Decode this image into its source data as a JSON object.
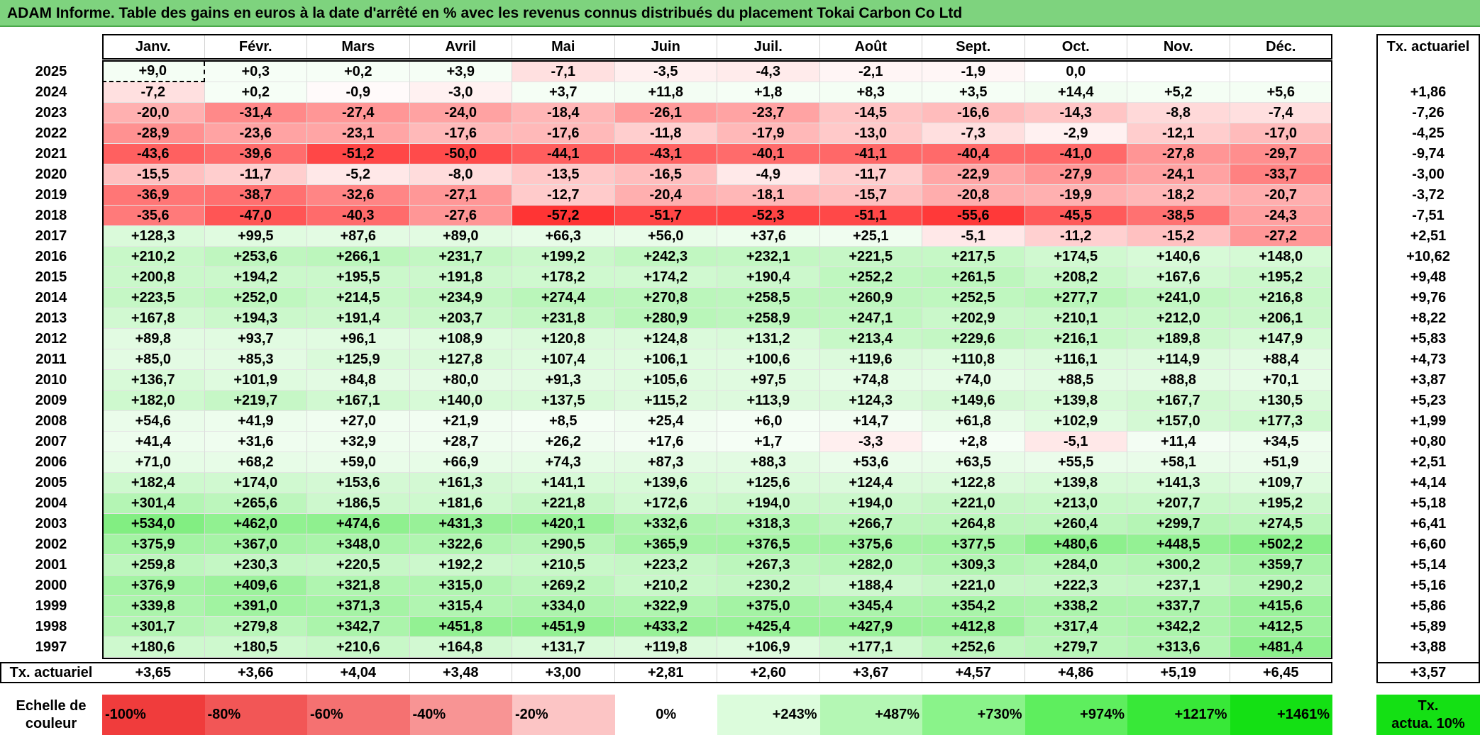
{
  "title": "ADAM Informe. Table des gains en euros à la date d'arrêté en % avec les revenus connus distribués du placement Tokai Carbon Co Ltd",
  "chart_data": {
    "type": "heatmap",
    "title": "ADAM Informe. Table des gains en euros à la date d'arrêté en % avec les revenus connus distribués du placement Tokai Carbon Co Ltd",
    "columns": [
      "Janv.",
      "Févr.",
      "Mars",
      "Avril",
      "Mai",
      "Juin",
      "Juil.",
      "Août",
      "Sept.",
      "Oct.",
      "Nov.",
      "Déc."
    ],
    "right_header": "Tx. actuariel",
    "rows": [
      {
        "year": "2025",
        "values": [
          "+9,0",
          "+0,3",
          "+0,2",
          "+3,9",
          "-7,1",
          "-3,5",
          "-4,3",
          "-2,1",
          "-1,9",
          "0,0",
          "",
          ""
        ],
        "rate": ""
      },
      {
        "year": "2024",
        "values": [
          "-7,2",
          "+0,2",
          "-0,9",
          "-3,0",
          "+3,7",
          "+11,8",
          "+1,8",
          "+8,3",
          "+3,5",
          "+14,4",
          "+5,2",
          "+5,6"
        ],
        "rate": "+1,86"
      },
      {
        "year": "2023",
        "values": [
          "-20,0",
          "-31,4",
          "-27,4",
          "-24,0",
          "-18,4",
          "-26,1",
          "-23,7",
          "-14,5",
          "-16,6",
          "-14,3",
          "-8,8",
          "-7,4"
        ],
        "rate": "-7,26"
      },
      {
        "year": "2022",
        "values": [
          "-28,9",
          "-23,6",
          "-23,1",
          "-17,6",
          "-17,6",
          "-11,8",
          "-17,9",
          "-13,0",
          "-7,3",
          "-2,9",
          "-12,1",
          "-17,0"
        ],
        "rate": "-4,25"
      },
      {
        "year": "2021",
        "values": [
          "-43,6",
          "-39,6",
          "-51,2",
          "-50,0",
          "-44,1",
          "-43,1",
          "-40,1",
          "-41,1",
          "-40,4",
          "-41,0",
          "-27,8",
          "-29,7"
        ],
        "rate": "-9,74"
      },
      {
        "year": "2020",
        "values": [
          "-15,5",
          "-11,7",
          "-5,2",
          "-8,0",
          "-13,5",
          "-16,5",
          "-4,9",
          "-11,7",
          "-22,9",
          "-27,9",
          "-24,1",
          "-33,7"
        ],
        "rate": "-3,00"
      },
      {
        "year": "2019",
        "values": [
          "-36,9",
          "-38,7",
          "-32,6",
          "-27,1",
          "-12,7",
          "-20,4",
          "-18,1",
          "-15,7",
          "-20,8",
          "-19,9",
          "-18,2",
          "-20,7"
        ],
        "rate": "-3,72"
      },
      {
        "year": "2018",
        "values": [
          "-35,6",
          "-47,0",
          "-40,3",
          "-27,6",
          "-57,2",
          "-51,7",
          "-52,3",
          "-51,1",
          "-55,6",
          "-45,5",
          "-38,5",
          "-24,3"
        ],
        "rate": "-7,51"
      },
      {
        "year": "2017",
        "values": [
          "+128,3",
          "+99,5",
          "+87,6",
          "+89,0",
          "+66,3",
          "+56,0",
          "+37,6",
          "+25,1",
          "-5,1",
          "-11,2",
          "-15,2",
          "-27,2"
        ],
        "rate": "+2,51"
      },
      {
        "year": "2016",
        "values": [
          "+210,2",
          "+253,6",
          "+266,1",
          "+231,7",
          "+199,2",
          "+242,3",
          "+232,1",
          "+221,5",
          "+217,5",
          "+174,5",
          "+140,6",
          "+148,0"
        ],
        "rate": "+10,62"
      },
      {
        "year": "2015",
        "values": [
          "+200,8",
          "+194,2",
          "+195,5",
          "+191,8",
          "+178,2",
          "+174,2",
          "+190,4",
          "+252,2",
          "+261,5",
          "+208,2",
          "+167,6",
          "+195,2"
        ],
        "rate": "+9,48"
      },
      {
        "year": "2014",
        "values": [
          "+223,5",
          "+252,0",
          "+214,5",
          "+234,9",
          "+274,4",
          "+270,8",
          "+258,5",
          "+260,9",
          "+252,5",
          "+277,7",
          "+241,0",
          "+216,8"
        ],
        "rate": "+9,76"
      },
      {
        "year": "2013",
        "values": [
          "+167,8",
          "+194,3",
          "+191,4",
          "+203,7",
          "+231,8",
          "+280,9",
          "+258,9",
          "+247,1",
          "+202,9",
          "+210,1",
          "+212,0",
          "+206,1"
        ],
        "rate": "+8,22"
      },
      {
        "year": "2012",
        "values": [
          "+89,8",
          "+93,7",
          "+96,1",
          "+108,9",
          "+120,8",
          "+124,8",
          "+131,2",
          "+213,4",
          "+229,6",
          "+216,1",
          "+189,8",
          "+147,9"
        ],
        "rate": "+5,83"
      },
      {
        "year": "2011",
        "values": [
          "+85,0",
          "+85,3",
          "+125,9",
          "+127,8",
          "+107,4",
          "+106,1",
          "+100,6",
          "+119,6",
          "+110,8",
          "+116,1",
          "+114,9",
          "+88,4"
        ],
        "rate": "+4,73"
      },
      {
        "year": "2010",
        "values": [
          "+136,7",
          "+101,9",
          "+84,8",
          "+80,0",
          "+91,3",
          "+105,6",
          "+97,5",
          "+74,8",
          "+74,0",
          "+88,5",
          "+88,8",
          "+70,1"
        ],
        "rate": "+3,87"
      },
      {
        "year": "2009",
        "values": [
          "+182,0",
          "+219,7",
          "+167,1",
          "+140,0",
          "+137,5",
          "+115,2",
          "+113,9",
          "+124,3",
          "+149,6",
          "+139,8",
          "+167,7",
          "+130,5"
        ],
        "rate": "+5,23"
      },
      {
        "year": "2008",
        "values": [
          "+54,6",
          "+41,9",
          "+27,0",
          "+21,9",
          "+8,5",
          "+25,4",
          "+6,0",
          "+14,7",
          "+61,8",
          "+102,9",
          "+157,0",
          "+177,3"
        ],
        "rate": "+1,99"
      },
      {
        "year": "2007",
        "values": [
          "+41,4",
          "+31,6",
          "+32,9",
          "+28,7",
          "+26,2",
          "+17,6",
          "+1,7",
          "-3,3",
          "+2,8",
          "-5,1",
          "+11,4",
          "+34,5"
        ],
        "rate": "+0,80"
      },
      {
        "year": "2006",
        "values": [
          "+71,0",
          "+68,2",
          "+59,0",
          "+66,9",
          "+74,3",
          "+87,3",
          "+88,3",
          "+53,6",
          "+63,5",
          "+55,5",
          "+58,1",
          "+51,9"
        ],
        "rate": "+2,51"
      },
      {
        "year": "2005",
        "values": [
          "+182,4",
          "+174,0",
          "+153,6",
          "+161,3",
          "+141,1",
          "+139,6",
          "+125,6",
          "+124,4",
          "+122,8",
          "+139,8",
          "+141,3",
          "+109,7"
        ],
        "rate": "+4,14"
      },
      {
        "year": "2004",
        "values": [
          "+301,4",
          "+265,6",
          "+186,5",
          "+181,6",
          "+221,8",
          "+172,6",
          "+194,0",
          "+194,0",
          "+221,0",
          "+213,0",
          "+207,7",
          "+195,2"
        ],
        "rate": "+5,18"
      },
      {
        "year": "2003",
        "values": [
          "+534,0",
          "+462,0",
          "+474,6",
          "+431,3",
          "+420,1",
          "+332,6",
          "+318,3",
          "+266,7",
          "+264,8",
          "+260,4",
          "+299,7",
          "+274,5"
        ],
        "rate": "+6,41"
      },
      {
        "year": "2002",
        "values": [
          "+375,9",
          "+367,0",
          "+348,0",
          "+322,6",
          "+290,5",
          "+365,9",
          "+376,5",
          "+375,6",
          "+377,5",
          "+480,6",
          "+448,5",
          "+502,2"
        ],
        "rate": "+6,60"
      },
      {
        "year": "2001",
        "values": [
          "+259,8",
          "+230,3",
          "+220,5",
          "+192,2",
          "+210,5",
          "+223,2",
          "+267,3",
          "+282,0",
          "+309,3",
          "+284,0",
          "+300,2",
          "+359,7"
        ],
        "rate": "+5,14"
      },
      {
        "year": "2000",
        "values": [
          "+376,9",
          "+409,6",
          "+321,8",
          "+315,0",
          "+269,2",
          "+210,2",
          "+230,2",
          "+188,4",
          "+221,0",
          "+222,3",
          "+237,1",
          "+290,2"
        ],
        "rate": "+5,16"
      },
      {
        "year": "1999",
        "values": [
          "+339,8",
          "+391,0",
          "+371,3",
          "+315,4",
          "+334,0",
          "+322,9",
          "+375,0",
          "+345,4",
          "+354,2",
          "+338,2",
          "+337,7",
          "+415,6"
        ],
        "rate": "+5,86"
      },
      {
        "year": "1998",
        "values": [
          "+301,7",
          "+279,8",
          "+342,7",
          "+451,8",
          "+451,9",
          "+433,2",
          "+425,4",
          "+427,9",
          "+412,8",
          "+317,4",
          "+342,2",
          "+412,5"
        ],
        "rate": "+5,89"
      },
      {
        "year": "1997",
        "values": [
          "+180,6",
          "+180,5",
          "+210,6",
          "+164,8",
          "+131,7",
          "+119,8",
          "+106,9",
          "+177,1",
          "+252,6",
          "+279,7",
          "+313,6",
          "+481,4"
        ],
        "rate": "+3,88"
      }
    ],
    "footer": {
      "label": "Tx. actuariel",
      "values": [
        "+3,65",
        "+3,66",
        "+4,04",
        "+3,48",
        "+3,00",
        "+2,81",
        "+2,60",
        "+3,67",
        "+4,57",
        "+4,86",
        "+5,19",
        "+6,45"
      ],
      "total": "+3,57"
    },
    "scale": {
      "label_line1": "Echelle de",
      "label_line2": "couleur",
      "stops": [
        {
          "text": "-100%",
          "color": "#f03c3c"
        },
        {
          "text": "-80%",
          "color": "#f25656"
        },
        {
          "text": "-60%",
          "color": "#f57171"
        },
        {
          "text": "-40%",
          "color": "#f89494"
        },
        {
          "text": "-20%",
          "color": "#fcc5c5"
        },
        {
          "text": "0%",
          "color": "#ffffff"
        },
        {
          "text": "+243%",
          "color": "#dcfcdc"
        },
        {
          "text": "+487%",
          "color": "#b4f7b4"
        },
        {
          "text": "+730%",
          "color": "#8af38a"
        },
        {
          "text": "+974%",
          "color": "#5eee5e"
        },
        {
          "text": "+1217%",
          "color": "#38e838"
        },
        {
          "text": "+1461%",
          "color": "#14e014"
        }
      ],
      "right_line1": "Tx.",
      "right_line2": "actua. 10%",
      "right_color": "#14e014"
    },
    "colors": {
      "negative_max": "#ff2b2b",
      "positive_max": "#14e014",
      "title_bg": "#7ed37e"
    }
  }
}
